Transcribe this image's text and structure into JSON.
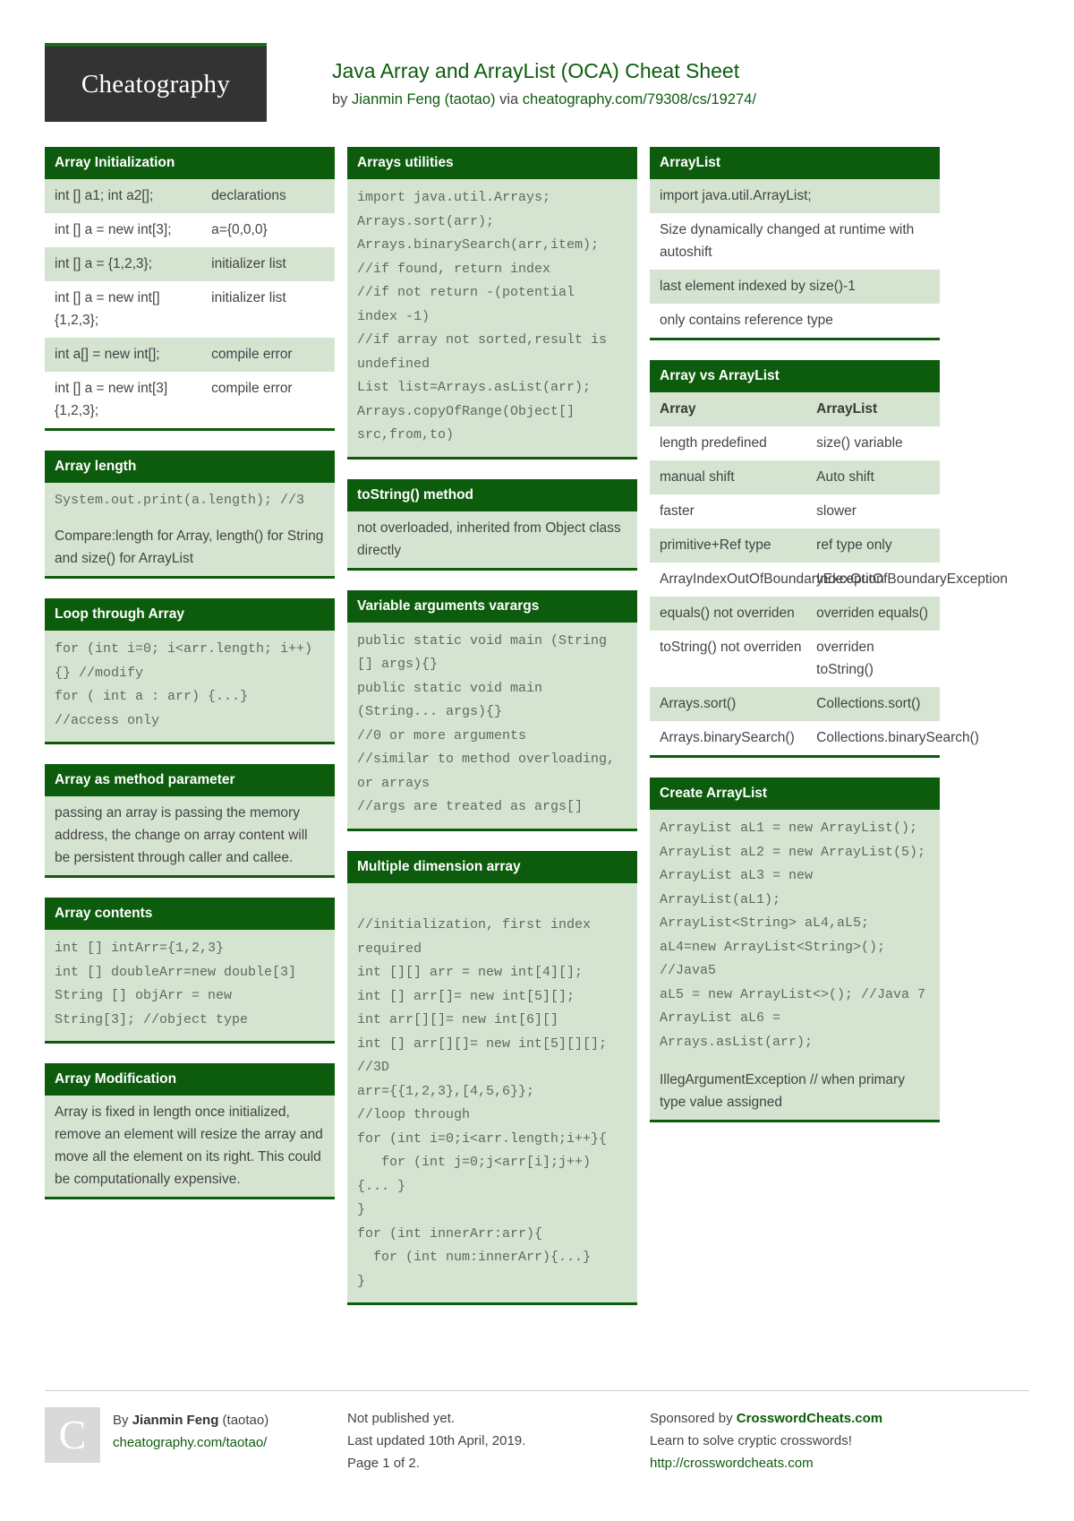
{
  "header": {
    "logo": "Cheatography",
    "title": "Java Array and ArrayList (OCA) Cheat Sheet",
    "by_prefix": "by ",
    "author": "Jianmin Feng (taotao)",
    "via": " via ",
    "source_url": "cheatography.com/79308/cs/19274/"
  },
  "columns": [
    {
      "cards": [
        {
          "title": "Array Initialization",
          "type": "kv",
          "rows": [
            {
              "k": "int [] a1; int a2[];",
              "v": "declarations"
            },
            {
              "k": "int [] a = new int[3];",
              "v": "a={0,0,0}"
            },
            {
              "k": "int [] a = {1,2,3};",
              "v": "initializer list"
            },
            {
              "k": "int [] a = new int[] {1,2,3};",
              "v": "initializer list"
            },
            {
              "k": "int a[] = new int[];",
              "v": "compile error"
            },
            {
              "k": "int [] a = new int[3] {1,2,3};",
              "v": "compile error"
            }
          ]
        },
        {
          "title": "Array length",
          "type": "mixed",
          "blocks": [
            {
              "kind": "code",
              "text": "System.out.print(a.length); //3"
            },
            {
              "kind": "text",
              "text": "Compare:length for Array, length() for String and size() for ArrayList"
            }
          ]
        },
        {
          "title": "Loop through Array",
          "type": "code",
          "code": "for (int i=0; i<arr.length; i++)\n{} //modify\nfor ( int a : arr) {...}\n//access only"
        },
        {
          "title": "Array as method parameter",
          "type": "text",
          "text": "passing an array is passing the memory address, the change on array content will be persistent through caller and callee."
        },
        {
          "title": "Array contents",
          "type": "code",
          "code": "int [] intArr={1,2,3}\nint [] doubleArr=new double[3]\nString [] objArr = new\nString[3]; //object type"
        },
        {
          "title": "Array Modification",
          "type": "text",
          "text": "Array is fixed in length once initialized, remove an element will resize the array and move all the element on its right. This could be computationally expensive."
        }
      ]
    },
    {
      "cards": [
        {
          "title": "Arrays utilities",
          "type": "code",
          "code": "import java.util.Arrays;\nArrays.sort(arr);\nArrays.binarySearch(arr,item);\n//if found, return index\n//if not return -(potential\nindex -1)\n//if array not sorted,result is\nundefined\nList list=Arrays.asList(arr);\nArrays.copyOfRange(Object[]\nsrc,from,to)"
        },
        {
          "title": "toString() method",
          "type": "text",
          "text": "not overloaded, inherited from Object class directly"
        },
        {
          "title": "Variable arguments varargs",
          "type": "code",
          "code": "public static void main (String\n[] args){}\npublic static void main\n(String... args){}\n//0 or more arguments\n//similar to method overloading,\nor arrays\n//args are treated as args[]"
        },
        {
          "title": "Multiple dimension array",
          "type": "code",
          "code": "\n//initialization, first index\nrequired\nint [][] arr = new int[4][];\nint [] arr[]= new int[5][];\nint arr[][]= new int[6][]\nint [] arr[][]= new int[5][][];\n//3D\narr={{1,2,3},[4,5,6}};\n//loop through\nfor (int i=0;i<arr.length;i++}{\n   for (int j=0;j<arr[i];j++)\n{... }\n}\nfor (int innerArr:arr){\n  for (int num:innerArr){...}\n}"
        }
      ]
    },
    {
      "cards": [
        {
          "title": "ArrayList",
          "type": "rows",
          "rows": [
            "import java.util.ArrayList;",
            "Size dynamically changed at runtime with autoshift",
            "last element indexed by size()-1",
            "only contains reference type"
          ]
        },
        {
          "title": "Array vs ArrayList",
          "type": "kv",
          "header": {
            "k": "Array",
            "v": "ArrayList"
          },
          "rows": [
            {
              "k": "length predefined",
              "v": "size() variable"
            },
            {
              "k": "manual shift",
              "v": "Auto shift"
            },
            {
              "k": "faster",
              "v": "slower"
            },
            {
              "k": "primitive+Ref type",
              "v": "ref type only"
            },
            {
              "k": "ArrayIndexOutOfBoundaryException",
              "v": "IndexOutOfBoundaryException"
            },
            {
              "k": "equals() not overriden",
              "v": "overriden equals()"
            },
            {
              "k": "toString() not overriden",
              "v": "overriden toString()"
            },
            {
              "k": "Arrays.sort()",
              "v": "Collections.sort()"
            },
            {
              "k": "Arrays.binarySearch()",
              "v": "Collections.binarySearch()"
            }
          ]
        },
        {
          "title": "Create ArrayList",
          "type": "mixed",
          "blocks": [
            {
              "kind": "code",
              "text": "ArrayList aL1 = new ArrayList();\nArrayList aL2 = new ArrayList(5);\nArrayList aL3 = new ArrayList(aL1);\nArrayList<String> aL4,aL5;\naL4=new ArrayList<String>();\n//Java5\naL5 = new ArrayList<>(); //Java 7\nArrayList aL6 = Arrays.asList(arr);"
            },
            {
              "kind": "text",
              "text": "IllegArgumentException // when primary type value assigned"
            }
          ]
        }
      ]
    }
  ],
  "footer": {
    "badge": "C",
    "by_label": "By ",
    "author": "Jianmin Feng",
    "author_suffix": " (taotao)",
    "author_url": "cheatography.com/taotao/",
    "publish_status": "Not published yet.",
    "last_updated": "Last updated 10th April, 2019.",
    "page_number": "Page 1 of 2.",
    "sponsor_prefix": "Sponsored by ",
    "sponsor_name": "CrosswordCheats.com",
    "sponsor_tagline": "Learn to solve cryptic crosswords!",
    "sponsor_url": "http://crosswordcheats.com"
  }
}
